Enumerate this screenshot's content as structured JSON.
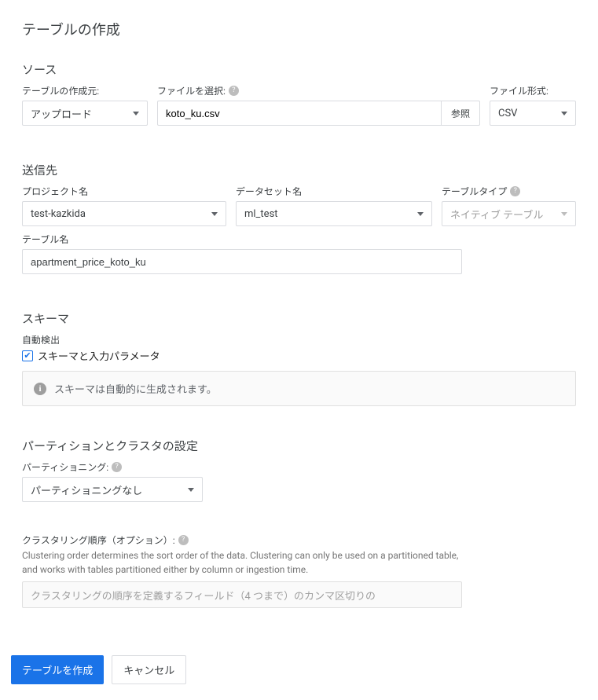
{
  "title": "テーブルの作成",
  "source": {
    "heading": "ソース",
    "origin_label": "テーブルの作成元:",
    "origin_value": "アップロード",
    "file_label": "ファイルを選択:",
    "file_value": "koto_ku.csv",
    "browse_label": "参照",
    "format_label": "ファイル形式:",
    "format_value": "CSV"
  },
  "destination": {
    "heading": "送信先",
    "project_label": "プロジェクト名",
    "project_value": "test-kazkida",
    "dataset_label": "データセット名",
    "dataset_value": "ml_test",
    "tabletype_label": "テーブルタイプ",
    "tabletype_value": "ネイティブ テーブル",
    "tablename_label": "テーブル名",
    "tablename_value": "apartment_price_koto_ku"
  },
  "schema": {
    "heading": "スキーマ",
    "auto_label": "自動検出",
    "checkbox_label": "スキーマと入力パラメータ",
    "info_text": "スキーマは自動的に生成されます。"
  },
  "partition": {
    "heading": "パーティションとクラスタの設定",
    "partition_label": "パーティショニング:",
    "partition_value": "パーティショニングなし",
    "cluster_label": "クラスタリング順序（オプション）:",
    "cluster_desc": "Clustering order determines the sort order of the data. Clustering can only be used on a partitioned table, and works with tables partitioned either by column or ingestion time.",
    "cluster_placeholder": "クラスタリングの順序を定義するフィールド（4 つまで）のカンマ区切りの"
  },
  "footer": {
    "create": "テーブルを作成",
    "cancel": "キャンセル"
  }
}
